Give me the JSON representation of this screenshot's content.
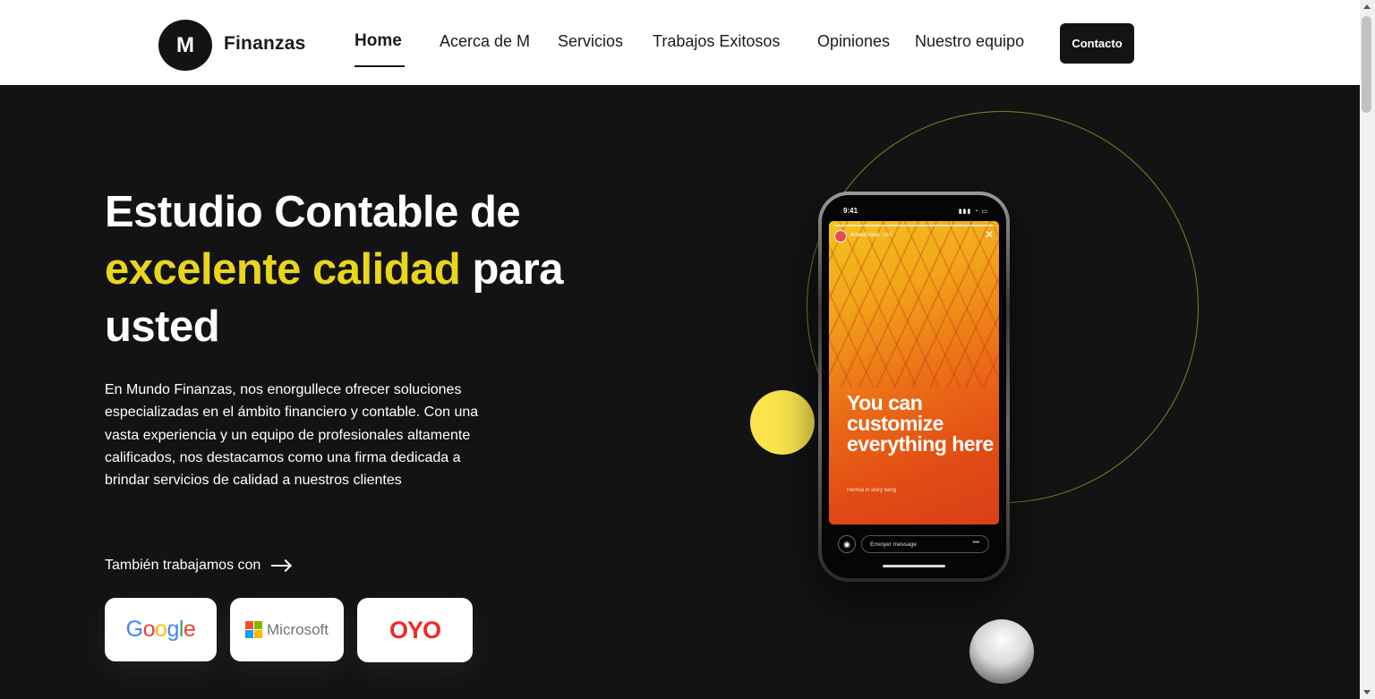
{
  "header": {
    "logo_letter": "M",
    "logo_text": "Finanzas",
    "nav": [
      {
        "label": "Home"
      },
      {
        "label": "Acerca de M"
      },
      {
        "label": "Servicios"
      },
      {
        "label": "Trabajos Exitosos"
      },
      {
        "label": "Opiniones"
      },
      {
        "label": "Nuestro equipo"
      }
    ],
    "active_nav": "Home",
    "contact_label": "Contacto"
  },
  "hero": {
    "title_line1": "Estudio Contable de",
    "title_highlight": "excelente calidad",
    "title_after_highlight": " para",
    "title_line3": "usted",
    "description": "En Mundo Finanzas, nos enorgullece ofrecer soluciones especializadas en el ámbito financiero y contable. Con una vasta experiencia y un equipo de profesionales altamente calificados, nos destacamos como una firma dedicada a brindar servicios de calidad a nuestros clientes",
    "partners_label": "También trabajamos con",
    "partners": [
      {
        "name": "Google"
      },
      {
        "name": "Microsoft"
      },
      {
        "name": "OYO"
      }
    ]
  },
  "phone": {
    "time": "9:41",
    "story_user": "AmeoGroup",
    "story_time": "23h",
    "story_headline": "You can customize everything here",
    "story_caption": "Permal in story bang",
    "message_placeholder": "Envoyer message"
  },
  "colors": {
    "accent": "#e9d51c",
    "background": "#131314",
    "yellow_dot": "#fbe54d"
  }
}
